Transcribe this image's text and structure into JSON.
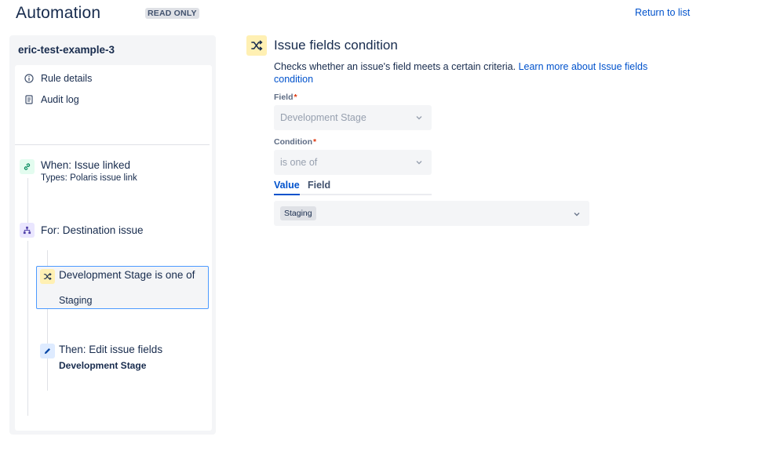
{
  "header": {
    "title": "Automation",
    "badge": "READ ONLY",
    "return_link": "Return to list"
  },
  "sidebar": {
    "rule_name": "eric-test-example-3",
    "nav": [
      {
        "label": "Rule details",
        "icon": "info-icon"
      },
      {
        "label": "Audit log",
        "icon": "audit-log-icon"
      }
    ],
    "steps": {
      "trigger": {
        "title": "When: Issue linked",
        "subtitle": "Types: Polaris issue link",
        "icon": "link-icon",
        "color": "#e3fcef"
      },
      "branch": {
        "title": "For: Destination issue",
        "icon": "branch-icon",
        "color": "#eae6ff"
      },
      "condition": {
        "title": "Development Stage is one of",
        "subtitle": "Staging",
        "icon": "shuffle-icon",
        "color": "#fff0b3"
      },
      "action": {
        "title": "Then: Edit issue fields",
        "subtitle": "Development Stage",
        "icon": "pencil-icon",
        "color": "#deebff"
      }
    }
  },
  "main": {
    "title": "Issue fields condition",
    "description": "Checks whether an issue's field meets a certain criteria.",
    "learn_more": "Learn more about Issue fields condition",
    "field_label": "Field",
    "field_value": "Development Stage",
    "condition_label": "Condition",
    "condition_value": "is one of",
    "required_marker": "*",
    "tabs": [
      {
        "label": "Value",
        "active": true
      },
      {
        "label": "Field",
        "active": false
      }
    ],
    "value_tag": "Staging"
  },
  "colors": {
    "accent": "#0052cc",
    "selected_border": "#4c9aff",
    "required": "#de350b"
  }
}
